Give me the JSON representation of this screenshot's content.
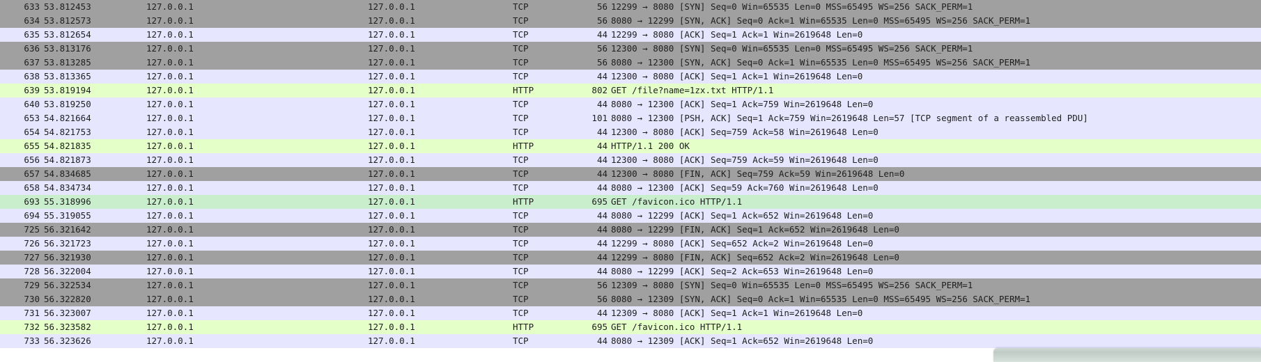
{
  "packet_list": {
    "rows": [
      {
        "no": "633",
        "time": "53.812453",
        "source": "127.0.0.1",
        "destination": "127.0.0.1",
        "protocol": "TCP",
        "length": "56",
        "info": "12299 → 8080 [SYN] Seq=0 Win=65535 Len=0 MSS=65495 WS=256 SACK_PERM=1",
        "style": "tcp-syn"
      },
      {
        "no": "634",
        "time": "53.812573",
        "source": "127.0.0.1",
        "destination": "127.0.0.1",
        "protocol": "TCP",
        "length": "56",
        "info": "8080 → 12299 [SYN, ACK] Seq=0 Ack=1 Win=65535 Len=0 MSS=65495 WS=256 SACK_PERM=1",
        "style": "tcp-syn"
      },
      {
        "no": "635",
        "time": "53.812654",
        "source": "127.0.0.1",
        "destination": "127.0.0.1",
        "protocol": "TCP",
        "length": "44",
        "info": "12299 → 8080 [ACK] Seq=1 Ack=1 Win=2619648 Len=0",
        "style": "tcp"
      },
      {
        "no": "636",
        "time": "53.813176",
        "source": "127.0.0.1",
        "destination": "127.0.0.1",
        "protocol": "TCP",
        "length": "56",
        "info": "12300 → 8080 [SYN] Seq=0 Win=65535 Len=0 MSS=65495 WS=256 SACK_PERM=1",
        "style": "tcp-syn"
      },
      {
        "no": "637",
        "time": "53.813285",
        "source": "127.0.0.1",
        "destination": "127.0.0.1",
        "protocol": "TCP",
        "length": "56",
        "info": "8080 → 12300 [SYN, ACK] Seq=0 Ack=1 Win=65535 Len=0 MSS=65495 WS=256 SACK_PERM=1",
        "style": "tcp-syn"
      },
      {
        "no": "638",
        "time": "53.813365",
        "source": "127.0.0.1",
        "destination": "127.0.0.1",
        "protocol": "TCP",
        "length": "44",
        "info": "12300 → 8080 [ACK] Seq=1 Ack=1 Win=2619648 Len=0",
        "style": "tcp"
      },
      {
        "no": "639",
        "time": "53.819194",
        "source": "127.0.0.1",
        "destination": "127.0.0.1",
        "protocol": "HTTP",
        "length": "802",
        "info": "GET /file?name=1zx.txt HTTP/1.1",
        "style": "http"
      },
      {
        "no": "640",
        "time": "53.819250",
        "source": "127.0.0.1",
        "destination": "127.0.0.1",
        "protocol": "TCP",
        "length": "44",
        "info": "8080 → 12300 [ACK] Seq=1 Ack=759 Win=2619648 Len=0",
        "style": "tcp"
      },
      {
        "no": "653",
        "time": "54.821664",
        "source": "127.0.0.1",
        "destination": "127.0.0.1",
        "protocol": "TCP",
        "length": "101",
        "info": "8080 → 12300 [PSH, ACK] Seq=1 Ack=759 Win=2619648 Len=57 [TCP segment of a reassembled PDU]",
        "style": "tcp"
      },
      {
        "no": "654",
        "time": "54.821753",
        "source": "127.0.0.1",
        "destination": "127.0.0.1",
        "protocol": "TCP",
        "length": "44",
        "info": "12300 → 8080 [ACK] Seq=759 Ack=58 Win=2619648 Len=0",
        "style": "tcp"
      },
      {
        "no": "655",
        "time": "54.821835",
        "source": "127.0.0.1",
        "destination": "127.0.0.1",
        "protocol": "HTTP",
        "length": "44",
        "info": "HTTP/1.1 200 OK",
        "style": "http"
      },
      {
        "no": "656",
        "time": "54.821873",
        "source": "127.0.0.1",
        "destination": "127.0.0.1",
        "protocol": "TCP",
        "length": "44",
        "info": "12300 → 8080 [ACK] Seq=759 Ack=59 Win=2619648 Len=0",
        "style": "tcp"
      },
      {
        "no": "657",
        "time": "54.834685",
        "source": "127.0.0.1",
        "destination": "127.0.0.1",
        "protocol": "TCP",
        "length": "44",
        "info": "12300 → 8080 [FIN, ACK] Seq=759 Ack=59 Win=2619648 Len=0",
        "style": "tcp-syn"
      },
      {
        "no": "658",
        "time": "54.834734",
        "source": "127.0.0.1",
        "destination": "127.0.0.1",
        "protocol": "TCP",
        "length": "44",
        "info": "8080 → 12300 [ACK] Seq=59 Ack=760 Win=2619648 Len=0",
        "style": "tcp"
      },
      {
        "no": "693",
        "time": "55.318996",
        "source": "127.0.0.1",
        "destination": "127.0.0.1",
        "protocol": "HTTP",
        "length": "695",
        "info": "GET /favicon.ico HTTP/1.1",
        "style": "http-alt"
      },
      {
        "no": "694",
        "time": "55.319055",
        "source": "127.0.0.1",
        "destination": "127.0.0.1",
        "protocol": "TCP",
        "length": "44",
        "info": "8080 → 12299 [ACK] Seq=1 Ack=652 Win=2619648 Len=0",
        "style": "tcp"
      },
      {
        "no": "725",
        "time": "56.321642",
        "source": "127.0.0.1",
        "destination": "127.0.0.1",
        "protocol": "TCP",
        "length": "44",
        "info": "8080 → 12299 [FIN, ACK] Seq=1 Ack=652 Win=2619648 Len=0",
        "style": "tcp-syn"
      },
      {
        "no": "726",
        "time": "56.321723",
        "source": "127.0.0.1",
        "destination": "127.0.0.1",
        "protocol": "TCP",
        "length": "44",
        "info": "12299 → 8080 [ACK] Seq=652 Ack=2 Win=2619648 Len=0",
        "style": "tcp"
      },
      {
        "no": "727",
        "time": "56.321930",
        "source": "127.0.0.1",
        "destination": "127.0.0.1",
        "protocol": "TCP",
        "length": "44",
        "info": "12299 → 8080 [FIN, ACK] Seq=652 Ack=2 Win=2619648 Len=0",
        "style": "tcp-syn"
      },
      {
        "no": "728",
        "time": "56.322004",
        "source": "127.0.0.1",
        "destination": "127.0.0.1",
        "protocol": "TCP",
        "length": "44",
        "info": "8080 → 12299 [ACK] Seq=2 Ack=653 Win=2619648 Len=0",
        "style": "tcp"
      },
      {
        "no": "729",
        "time": "56.322534",
        "source": "127.0.0.1",
        "destination": "127.0.0.1",
        "protocol": "TCP",
        "length": "56",
        "info": "12309 → 8080 [SYN] Seq=0 Win=65535 Len=0 MSS=65495 WS=256 SACK_PERM=1",
        "style": "tcp-syn"
      },
      {
        "no": "730",
        "time": "56.322820",
        "source": "127.0.0.1",
        "destination": "127.0.0.1",
        "protocol": "TCP",
        "length": "56",
        "info": "8080 → 12309 [SYN, ACK] Seq=0 Ack=1 Win=65535 Len=0 MSS=65495 WS=256 SACK_PERM=1",
        "style": "tcp-syn"
      },
      {
        "no": "731",
        "time": "56.323007",
        "source": "127.0.0.1",
        "destination": "127.0.0.1",
        "protocol": "TCP",
        "length": "44",
        "info": "12309 → 8080 [ACK] Seq=1 Ack=1 Win=2619648 Len=0",
        "style": "tcp"
      },
      {
        "no": "732",
        "time": "56.323582",
        "source": "127.0.0.1",
        "destination": "127.0.0.1",
        "protocol": "HTTP",
        "length": "695",
        "info": "GET /favicon.ico HTTP/1.1",
        "style": "http"
      },
      {
        "no": "733",
        "time": "56.323626",
        "source": "127.0.0.1",
        "destination": "127.0.0.1",
        "protocol": "TCP",
        "length": "44",
        "info": "8080 → 12309 [ACK] Seq=1 Ack=652 Win=2619648 Len=0",
        "style": "tcp"
      }
    ]
  },
  "colors": {
    "tcp_syn_fin": "#a0a0a0",
    "tcp": "#e7e6ff",
    "http": "#e4ffc7",
    "http_alt": "#c8eecc",
    "text": "#1e1e1e"
  }
}
